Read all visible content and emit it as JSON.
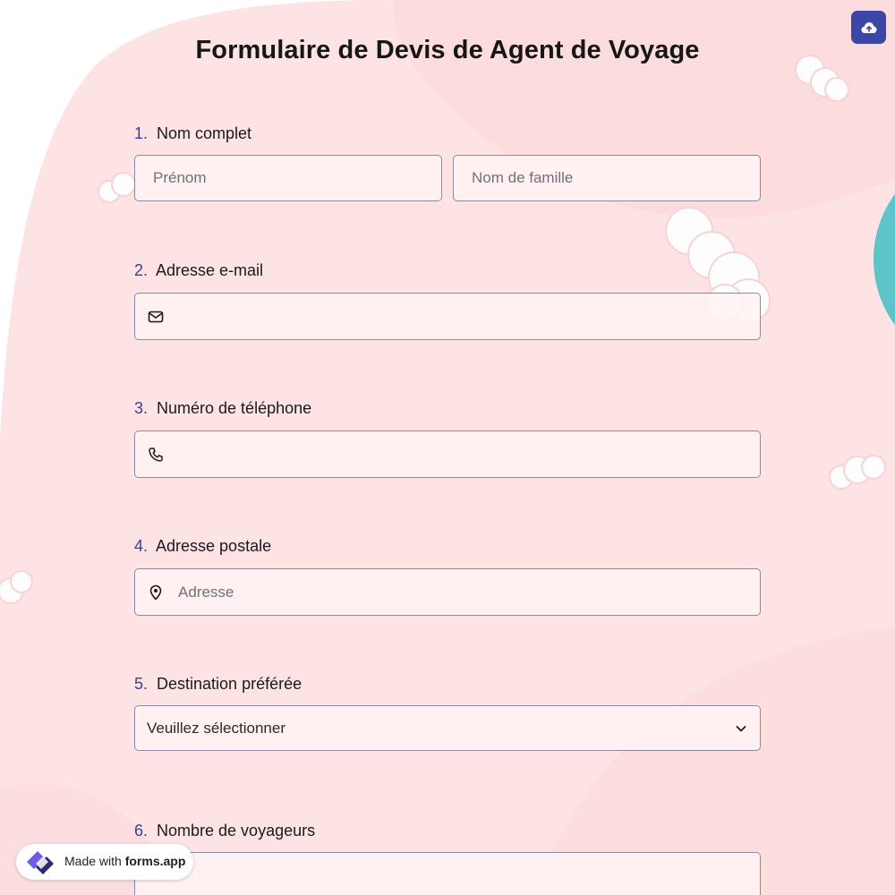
{
  "form": {
    "title": "Formulaire de Devis de Agent de Voyage"
  },
  "questions": [
    {
      "number": "1.",
      "label": "Nom complet",
      "fields": [
        {
          "placeholder": "Prénom"
        },
        {
          "placeholder": "Nom de famille"
        }
      ]
    },
    {
      "number": "2.",
      "label": "Adresse e-mail",
      "icon": "mail-icon",
      "placeholder": ""
    },
    {
      "number": "3.",
      "label": "Numéro de téléphone",
      "icon": "phone-icon",
      "placeholder": ""
    },
    {
      "number": "4.",
      "label": "Adresse postale",
      "icon": "map-pin-icon",
      "placeholder": "Adresse"
    },
    {
      "number": "5.",
      "label": "Destination préférée",
      "selected": "Veuillez sélectionner",
      "icon": "chevron-down-icon"
    },
    {
      "number": "6.",
      "label": "Nombre de voyageurs"
    }
  ],
  "toolbar": {
    "upload_icon": "cloud-upload-icon"
  },
  "badge": {
    "made_with": "Made with",
    "brand": "forms.app",
    "logo_icon": "forms-app-logo-icon"
  },
  "colors": {
    "accent": "#3b46a6",
    "background": "#fde4e5",
    "field_bg": "#fff3f4",
    "teal": "#5ec4c9"
  }
}
